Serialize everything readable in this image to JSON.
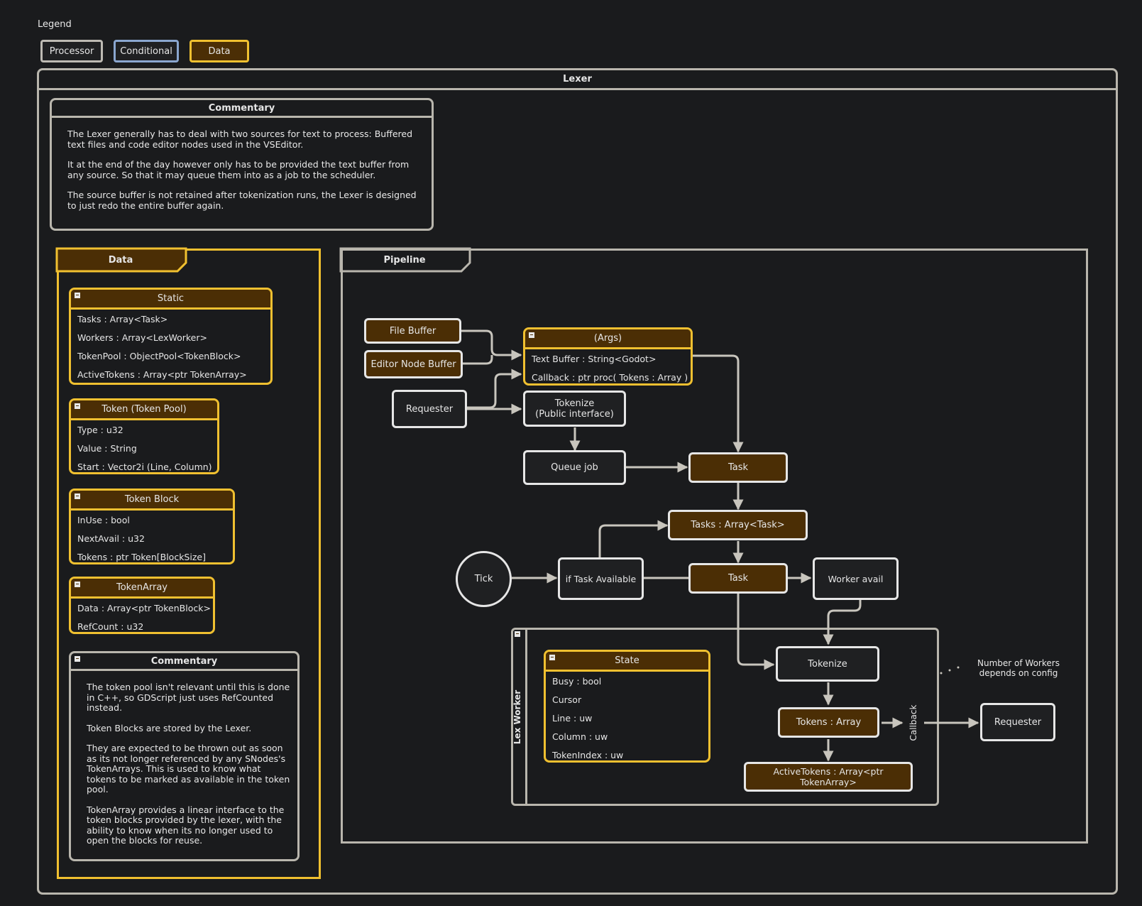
{
  "legend": {
    "title": "Legend",
    "items": [
      "Processor",
      "Conditional",
      "Data"
    ]
  },
  "lexer": {
    "title": "Lexer",
    "commentary": {
      "title": "Commentary",
      "paragraphs": [
        "The Lexer generally has to deal with two sources for text to process: Buffered text files and code editor nodes used in the VSEditor.",
        "It at the end of the day however only has to be provided the text buffer from any source. So that it may queue them into as a job to the scheduler.",
        "The source buffer is not retained after tokenization runs, the Lexer is designed to just redo the entire buffer again."
      ]
    },
    "data": {
      "title": "Data",
      "static": {
        "title": "Static",
        "rows": [
          "Tasks : Array<Task>",
          "Workers : Array<LexWorker>",
          "TokenPool : ObjectPool<TokenBlock>",
          "ActiveTokens : Array<ptr TokenArray>"
        ]
      },
      "token": {
        "title": "Token (Token Pool)",
        "rows": [
          "Type : u32",
          "Value : String",
          "Start :  Vector2i (Line, Column)"
        ]
      },
      "token_block": {
        "title": "Token Block",
        "rows": [
          "InUse : bool",
          "NextAvail : u32",
          "Tokens : ptr Token[BlockSize]"
        ]
      },
      "token_array": {
        "title": "TokenArray",
        "rows": [
          "Data : Array<ptr TokenBlock>",
          "RefCount : u32"
        ]
      },
      "commentary": {
        "title": "Commentary",
        "paragraphs": [
          "The token pool isn't relevant until this is done in C++, so GDScript just uses RefCounted instead.",
          "Token Blocks are stored by the Lexer.",
          "They are expected to be thrown out as soon as its not longer referenced by any SNodes's TokenArrays. This is used to know what tokens to be marked as available in the token pool.",
          "TokenArray provides a linear interface to the token blocks provided by the lexer, with the ability to  know when its no longer used to open the blocks for reuse."
        ]
      }
    },
    "pipeline": {
      "title": "Pipeline",
      "file_buffer": "File Buffer",
      "editor_node_buffer": "Editor Node Buffer",
      "requester": "Requester",
      "args": {
        "title": "(Args)",
        "rows": [
          "Text Buffer : String<Godot>",
          "Callback  :  ptr proc( Tokens : Array )"
        ]
      },
      "tokenize_public": [
        "Tokenize",
        "(Public interface)"
      ],
      "queue_job": "Queue job",
      "task_1": "Task",
      "tasks_array": "Tasks : Array<Task>",
      "tick": "Tick",
      "if_task_available": "if Task Available",
      "task_2": "Task",
      "worker_avail": "Worker avail",
      "lex_worker": {
        "title": "Lex Worker",
        "state": {
          "title": "State",
          "rows": [
            "Busy : bool",
            "Cursor",
            "Line : uw",
            "Column : uw",
            "TokenIndex : uw"
          ]
        },
        "tokenize": "Tokenize",
        "tokens_array": "Tokens : Array",
        "active_tokens": "ActiveTokens : Array<ptr TokenArray>",
        "callback": "Callback"
      },
      "workers_note": [
        "Number of Workers",
        "depends on config"
      ],
      "requester_out": "Requester"
    }
  },
  "colors": {
    "background": "#1a1b1d",
    "processor_border": "#bdbab3",
    "conditional_border": "#8aa6cf",
    "data_border": "#f0c030",
    "data_fill": "#4b2e05"
  }
}
